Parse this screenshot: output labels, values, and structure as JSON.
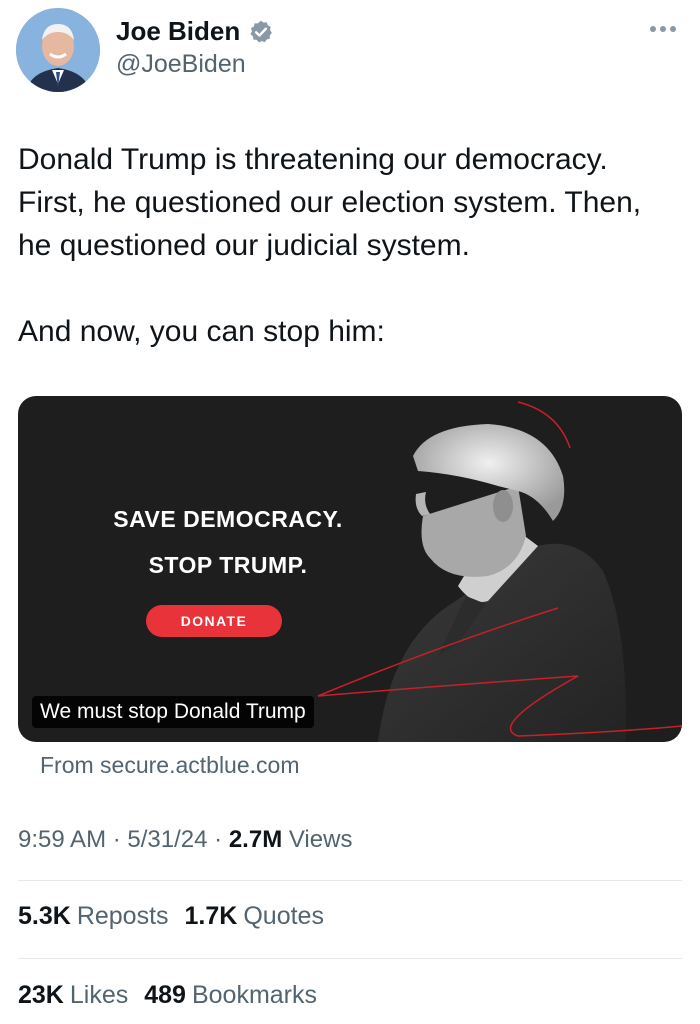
{
  "author": {
    "name": "Joe Biden",
    "handle": "@JoeBiden",
    "verified_icon": "verified-badge-icon",
    "avatar_icon": "avatar"
  },
  "tweet": {
    "text": "Donald Trump is threatening our democracy.\nFirst, he questioned our election system. Then,\nhe questioned our judicial system.\n\nAnd now, you can stop him:"
  },
  "card": {
    "line1": "SAVE DEMOCRACY.",
    "line2": "STOP TRUMP.",
    "donate_label": "DONATE",
    "caption": "We must stop Donald Trump",
    "source": "From secure.actblue.com"
  },
  "meta": {
    "time": "9:59 AM",
    "date": "5/31/24",
    "views_count": "2.7M",
    "views_label": "Views"
  },
  "stats": {
    "reposts_count": "5.3K",
    "reposts_label": "Reposts",
    "quotes_count": "1.7K",
    "quotes_label": "Quotes",
    "likes_count": "23K",
    "likes_label": "Likes",
    "bookmarks_count": "489",
    "bookmarks_label": "Bookmarks"
  },
  "colors": {
    "verified": "#8b98a5",
    "donate": "#e8333a",
    "card_bg": "#1e1e1e",
    "secondary_text": "#536471"
  }
}
